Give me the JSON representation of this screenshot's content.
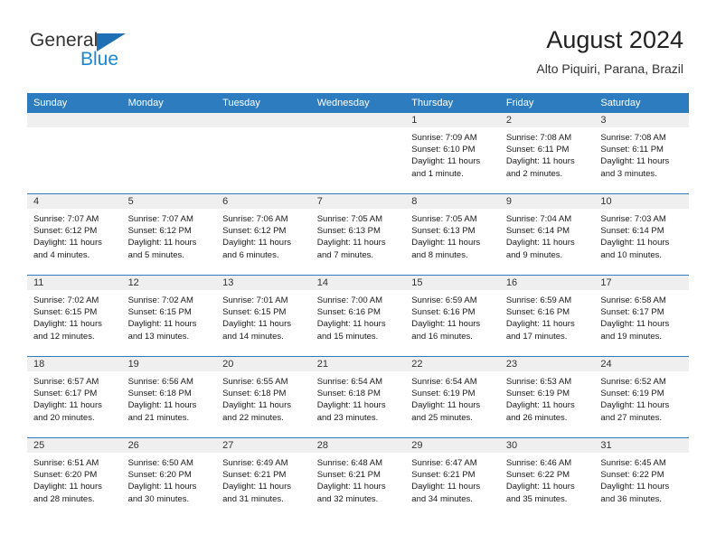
{
  "brand": {
    "line1": "General",
    "line2": "Blue",
    "triangle_color": "#1f6fb5"
  },
  "header": {
    "title": "August 2024",
    "subtitle": "Alto Piquiri, Parana, Brazil",
    "accent_color": "#2e7cc0",
    "datenum_band_color": "#efefef"
  },
  "calendar": {
    "weekday_headers": [
      "Sunday",
      "Monday",
      "Tuesday",
      "Wednesday",
      "Thursday",
      "Friday",
      "Saturday"
    ],
    "weeks": [
      [
        {
          "day": "",
          "empty": true,
          "lines": []
        },
        {
          "day": "",
          "empty": true,
          "lines": []
        },
        {
          "day": "",
          "empty": true,
          "lines": []
        },
        {
          "day": "",
          "empty": true,
          "lines": []
        },
        {
          "day": "1",
          "empty": false,
          "lines": [
            "Sunrise: 7:09 AM",
            "Sunset: 6:10 PM",
            "Daylight: 11 hours",
            "and 1 minute."
          ]
        },
        {
          "day": "2",
          "empty": false,
          "lines": [
            "Sunrise: 7:08 AM",
            "Sunset: 6:11 PM",
            "Daylight: 11 hours",
            "and 2 minutes."
          ]
        },
        {
          "day": "3",
          "empty": false,
          "lines": [
            "Sunrise: 7:08 AM",
            "Sunset: 6:11 PM",
            "Daylight: 11 hours",
            "and 3 minutes."
          ]
        }
      ],
      [
        {
          "day": "4",
          "empty": false,
          "lines": [
            "Sunrise: 7:07 AM",
            "Sunset: 6:12 PM",
            "Daylight: 11 hours",
            "and 4 minutes."
          ]
        },
        {
          "day": "5",
          "empty": false,
          "lines": [
            "Sunrise: 7:07 AM",
            "Sunset: 6:12 PM",
            "Daylight: 11 hours",
            "and 5 minutes."
          ]
        },
        {
          "day": "6",
          "empty": false,
          "lines": [
            "Sunrise: 7:06 AM",
            "Sunset: 6:12 PM",
            "Daylight: 11 hours",
            "and 6 minutes."
          ]
        },
        {
          "day": "7",
          "empty": false,
          "lines": [
            "Sunrise: 7:05 AM",
            "Sunset: 6:13 PM",
            "Daylight: 11 hours",
            "and 7 minutes."
          ]
        },
        {
          "day": "8",
          "empty": false,
          "lines": [
            "Sunrise: 7:05 AM",
            "Sunset: 6:13 PM",
            "Daylight: 11 hours",
            "and 8 minutes."
          ]
        },
        {
          "day": "9",
          "empty": false,
          "lines": [
            "Sunrise: 7:04 AM",
            "Sunset: 6:14 PM",
            "Daylight: 11 hours",
            "and 9 minutes."
          ]
        },
        {
          "day": "10",
          "empty": false,
          "lines": [
            "Sunrise: 7:03 AM",
            "Sunset: 6:14 PM",
            "Daylight: 11 hours",
            "and 10 minutes."
          ]
        }
      ],
      [
        {
          "day": "11",
          "empty": false,
          "lines": [
            "Sunrise: 7:02 AM",
            "Sunset: 6:15 PM",
            "Daylight: 11 hours",
            "and 12 minutes."
          ]
        },
        {
          "day": "12",
          "empty": false,
          "lines": [
            "Sunrise: 7:02 AM",
            "Sunset: 6:15 PM",
            "Daylight: 11 hours",
            "and 13 minutes."
          ]
        },
        {
          "day": "13",
          "empty": false,
          "lines": [
            "Sunrise: 7:01 AM",
            "Sunset: 6:15 PM",
            "Daylight: 11 hours",
            "and 14 minutes."
          ]
        },
        {
          "day": "14",
          "empty": false,
          "lines": [
            "Sunrise: 7:00 AM",
            "Sunset: 6:16 PM",
            "Daylight: 11 hours",
            "and 15 minutes."
          ]
        },
        {
          "day": "15",
          "empty": false,
          "lines": [
            "Sunrise: 6:59 AM",
            "Sunset: 6:16 PM",
            "Daylight: 11 hours",
            "and 16 minutes."
          ]
        },
        {
          "day": "16",
          "empty": false,
          "lines": [
            "Sunrise: 6:59 AM",
            "Sunset: 6:16 PM",
            "Daylight: 11 hours",
            "and 17 minutes."
          ]
        },
        {
          "day": "17",
          "empty": false,
          "lines": [
            "Sunrise: 6:58 AM",
            "Sunset: 6:17 PM",
            "Daylight: 11 hours",
            "and 19 minutes."
          ]
        }
      ],
      [
        {
          "day": "18",
          "empty": false,
          "lines": [
            "Sunrise: 6:57 AM",
            "Sunset: 6:17 PM",
            "Daylight: 11 hours",
            "and 20 minutes."
          ]
        },
        {
          "day": "19",
          "empty": false,
          "lines": [
            "Sunrise: 6:56 AM",
            "Sunset: 6:18 PM",
            "Daylight: 11 hours",
            "and 21 minutes."
          ]
        },
        {
          "day": "20",
          "empty": false,
          "lines": [
            "Sunrise: 6:55 AM",
            "Sunset: 6:18 PM",
            "Daylight: 11 hours",
            "and 22 minutes."
          ]
        },
        {
          "day": "21",
          "empty": false,
          "lines": [
            "Sunrise: 6:54 AM",
            "Sunset: 6:18 PM",
            "Daylight: 11 hours",
            "and 23 minutes."
          ]
        },
        {
          "day": "22",
          "empty": false,
          "lines": [
            "Sunrise: 6:54 AM",
            "Sunset: 6:19 PM",
            "Daylight: 11 hours",
            "and 25 minutes."
          ]
        },
        {
          "day": "23",
          "empty": false,
          "lines": [
            "Sunrise: 6:53 AM",
            "Sunset: 6:19 PM",
            "Daylight: 11 hours",
            "and 26 minutes."
          ]
        },
        {
          "day": "24",
          "empty": false,
          "lines": [
            "Sunrise: 6:52 AM",
            "Sunset: 6:19 PM",
            "Daylight: 11 hours",
            "and 27 minutes."
          ]
        }
      ],
      [
        {
          "day": "25",
          "empty": false,
          "lines": [
            "Sunrise: 6:51 AM",
            "Sunset: 6:20 PM",
            "Daylight: 11 hours",
            "and 28 minutes."
          ]
        },
        {
          "day": "26",
          "empty": false,
          "lines": [
            "Sunrise: 6:50 AM",
            "Sunset: 6:20 PM",
            "Daylight: 11 hours",
            "and 30 minutes."
          ]
        },
        {
          "day": "27",
          "empty": false,
          "lines": [
            "Sunrise: 6:49 AM",
            "Sunset: 6:21 PM",
            "Daylight: 11 hours",
            "and 31 minutes."
          ]
        },
        {
          "day": "28",
          "empty": false,
          "lines": [
            "Sunrise: 6:48 AM",
            "Sunset: 6:21 PM",
            "Daylight: 11 hours",
            "and 32 minutes."
          ]
        },
        {
          "day": "29",
          "empty": false,
          "lines": [
            "Sunrise: 6:47 AM",
            "Sunset: 6:21 PM",
            "Daylight: 11 hours",
            "and 34 minutes."
          ]
        },
        {
          "day": "30",
          "empty": false,
          "lines": [
            "Sunrise: 6:46 AM",
            "Sunset: 6:22 PM",
            "Daylight: 11 hours",
            "and 35 minutes."
          ]
        },
        {
          "day": "31",
          "empty": false,
          "lines": [
            "Sunrise: 6:45 AM",
            "Sunset: 6:22 PM",
            "Daylight: 11 hours",
            "and 36 minutes."
          ]
        }
      ]
    ]
  }
}
